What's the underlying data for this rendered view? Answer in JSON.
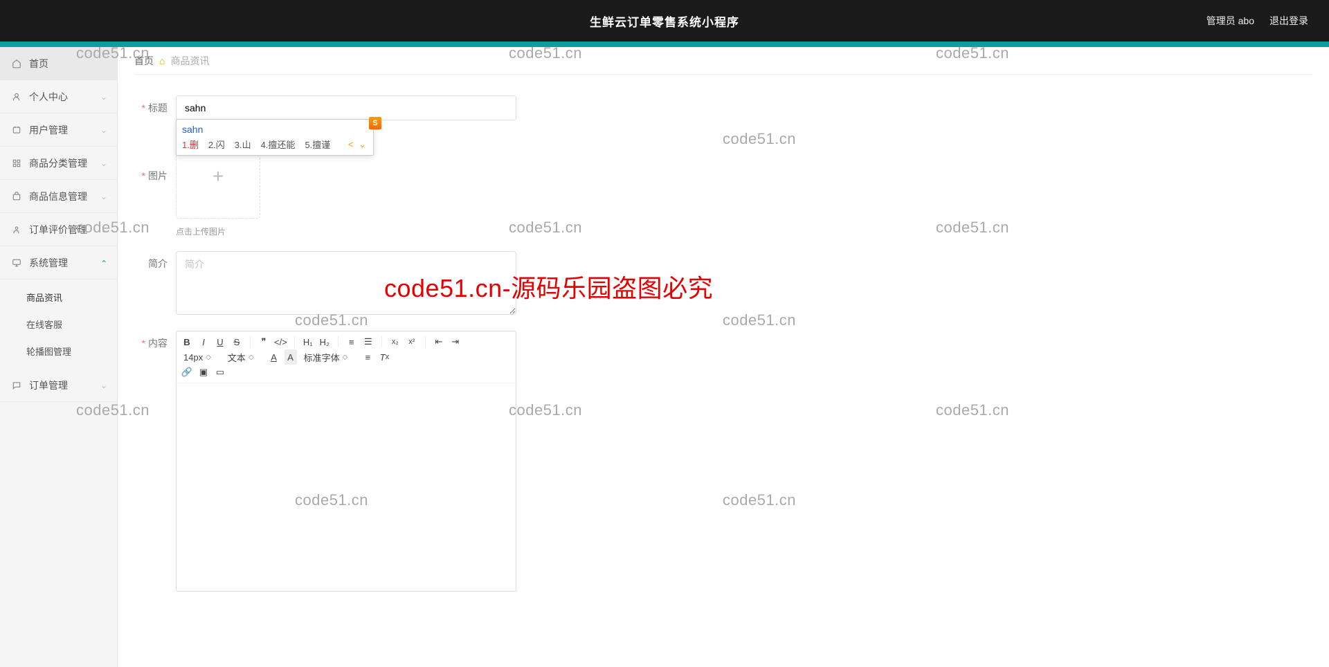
{
  "header": {
    "title": "生鲜云订单零售系统小程序",
    "admin_label": "管理员 abo",
    "logout_label": "退出登录"
  },
  "breadcrumb": {
    "home": "首页",
    "current": "商品资讯"
  },
  "sidebar": {
    "items": [
      {
        "label": "首页",
        "icon": "home"
      },
      {
        "label": "个人中心",
        "icon": "user",
        "submenu": true
      },
      {
        "label": "用户管理",
        "icon": "users",
        "submenu": true
      },
      {
        "label": "商品分类管理",
        "icon": "grid",
        "submenu": true
      },
      {
        "label": "商品信息管理",
        "icon": "box",
        "submenu": true
      },
      {
        "label": "订单评价管理",
        "icon": "review",
        "submenu": true
      },
      {
        "label": "系统管理",
        "icon": "monitor",
        "submenu": true,
        "expanded": true
      },
      {
        "label": "订单管理",
        "icon": "chat",
        "submenu": true
      }
    ],
    "system_sub": [
      {
        "label": "商品资讯"
      },
      {
        "label": "在线客服"
      },
      {
        "label": "轮播图管理"
      }
    ]
  },
  "form": {
    "title_label": "标题",
    "title_value": "sahn",
    "image_label": "图片",
    "image_hint": "点击上传图片",
    "intro_label": "简介",
    "intro_placeholder": "简介",
    "content_label": "内容"
  },
  "ime": {
    "buffer": "sahn",
    "tag": "S",
    "candidates": [
      {
        "n": "1.",
        "w": "删"
      },
      {
        "n": "2.",
        "w": "闪"
      },
      {
        "n": "3.",
        "w": "山"
      },
      {
        "n": "4.",
        "w": "擅还能"
      },
      {
        "n": "5.",
        "w": "擅谨"
      }
    ],
    "nav": "< >"
  },
  "editor": {
    "font_size": "14px",
    "block_type": "文本",
    "font_family": "标准字体",
    "h1": "H₁",
    "h2": "H₂",
    "sub": "x₂",
    "sup": "x²"
  },
  "watermark": {
    "text": "code51.cn",
    "center": "code51.cn-源码乐园盗图必究"
  }
}
